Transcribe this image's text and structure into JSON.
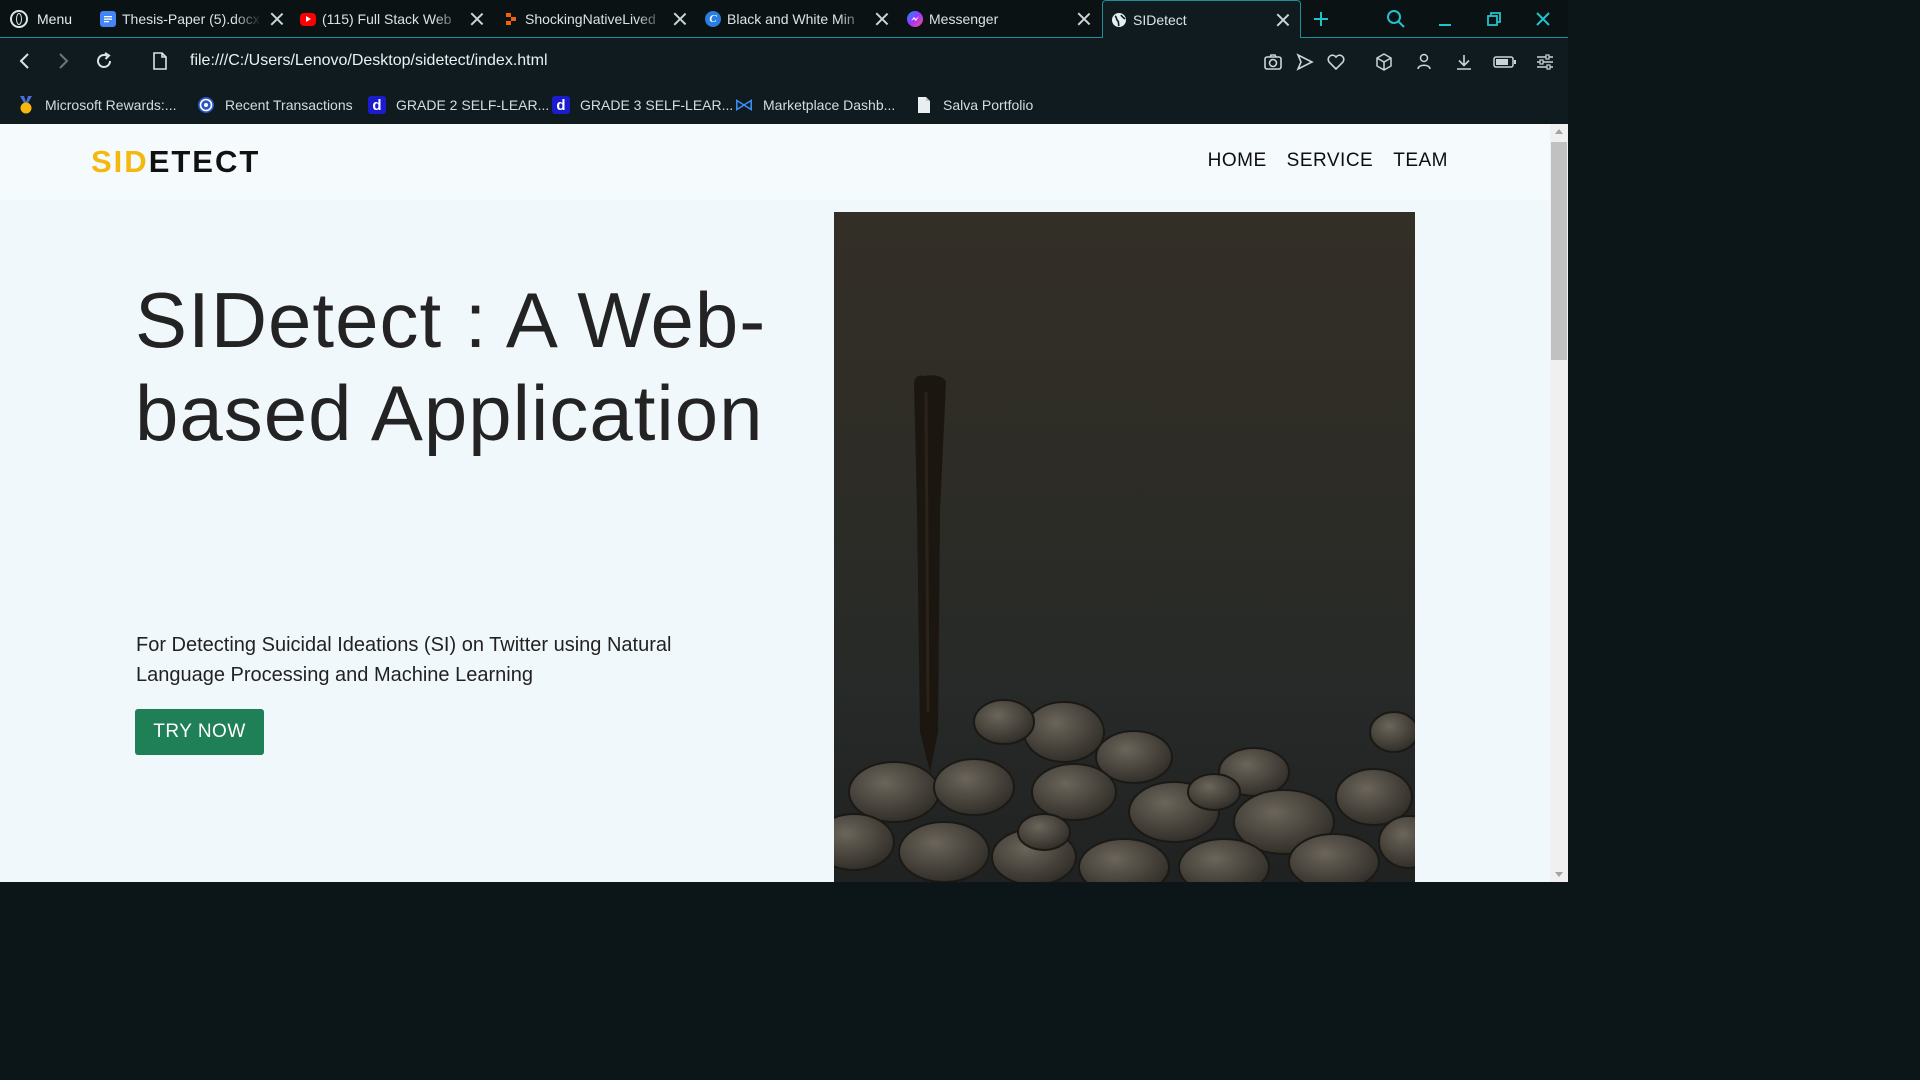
{
  "browser": {
    "menu_label": "Menu",
    "tabs": [
      {
        "title": "Thesis-Paper (5).docx",
        "icon": "google-docs-icon",
        "color": "#4285f4"
      },
      {
        "title": "(115) Full Stack Web",
        "icon": "youtube-icon",
        "color": "#ff0000"
      },
      {
        "title": "ShockingNativeLived",
        "icon": "replit-icon",
        "color": "#f26207"
      },
      {
        "title": "Black and White Min",
        "icon": "canva-icon",
        "color": "#2a7de1"
      },
      {
        "title": "Messenger",
        "icon": "messenger-icon",
        "color": "#a033ff"
      },
      {
        "title": "SIDetect",
        "icon": "globe-icon",
        "color": "#e6eef0"
      }
    ],
    "address": "file:///C:/Users/Lenovo/Desktop/sidetect/index.html",
    "bookmarks": [
      {
        "label": "Microsoft Rewards:...",
        "icon": "medal-icon"
      },
      {
        "label": "Recent Transactions",
        "icon": "coins-icon"
      },
      {
        "label": "GRADE 2 SELF-LEAR...",
        "icon": "d-icon"
      },
      {
        "label": "GRADE 3 SELF-LEAR...",
        "icon": "d-icon"
      },
      {
        "label": "Marketplace Dashb...",
        "icon": "visual-studio-icon"
      },
      {
        "label": "Salva Portfolio",
        "icon": "file-icon"
      }
    ],
    "accent_color": "#22c2cc"
  },
  "site": {
    "logo_accent": "SID",
    "logo_rest": "ETECT",
    "nav": [
      "HOME",
      "SERVICE",
      "TEAM"
    ],
    "hero_title": "SIDetect : A Web-based Application",
    "hero_subtitle": "For Detecting Suicidal Ideations (SI) on Twitter using Natural Language Processing and Machine Learning",
    "cta_label": "TRY NOW",
    "cta_color": "#1f7f57",
    "logo_accent_color": "#f5b80e"
  }
}
